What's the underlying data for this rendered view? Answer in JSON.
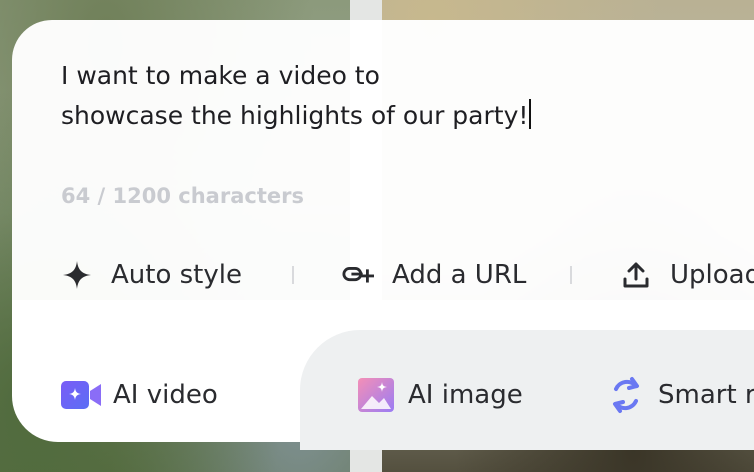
{
  "prompt": {
    "text": "I want to make a video to\nshowcase the highlights of our party!",
    "char_count": "64 / 1200 characters"
  },
  "actions": [
    {
      "label": "Auto style",
      "icon": "sparkle-icon"
    },
    {
      "label": "Add a URL",
      "icon": "link-add-icon"
    },
    {
      "label": "Upload",
      "icon": "upload-icon"
    }
  ],
  "modes": [
    {
      "label": "AI video",
      "icon": "video-camera-icon"
    },
    {
      "label": "AI image",
      "icon": "image-icon"
    },
    {
      "label": "Smart r",
      "icon": "refresh-icon"
    }
  ],
  "colors": {
    "video_icon_start": "#6a5cf5",
    "video_icon_end": "#8a6df7",
    "image_icon_start": "#f28bb8",
    "image_icon_end": "#9a7cf4",
    "refresh_icon": "#6a78f2",
    "counter_text": "#c9cbd0"
  }
}
